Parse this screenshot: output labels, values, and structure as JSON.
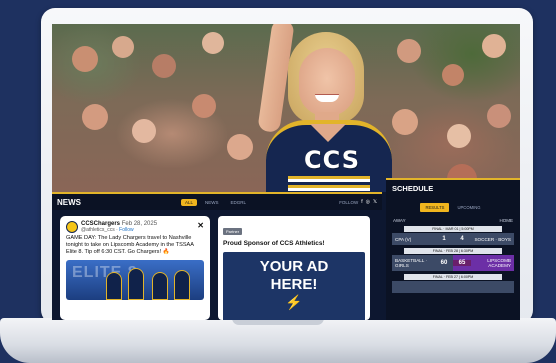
{
  "hero": {
    "jersey_text": "CCS"
  },
  "news": {
    "title": "NEWS",
    "tabs": [
      {
        "label": "ALL",
        "active": true
      },
      {
        "label": "NEWS",
        "active": false
      },
      {
        "label": "EDGRL",
        "active": false
      }
    ],
    "follow_label": "FOLLOW",
    "social_icons": [
      "f",
      "◎",
      "𝕏"
    ]
  },
  "tweet": {
    "name": "CCSChargers",
    "date": "Feb 28, 2025",
    "handle": "@athletics_ccs",
    "follow_label": "Follow",
    "text": "GAME DAY: The Lady Chargers travel to Nashville tonight to take on Lipscomb Academy in the TSSAA Elite 8. Tip off 6:30 CST. Go Chargers! 🔥",
    "image_text": "ELITE 8"
  },
  "ad": {
    "badge": "Partner",
    "sponsor_line": "Proud Sponsor of CCS Athletics!",
    "ad_line1": "YOUR AD",
    "ad_line2": "HERE!"
  },
  "schedule": {
    "title": "SCHEDULE",
    "tabs": [
      {
        "label": "RESULTS",
        "active": true
      },
      {
        "label": "UPCOMING",
        "active": false
      }
    ],
    "col_away": "AWAY",
    "col_home": "HOME",
    "games": [
      {
        "label": "FINAL · MAR 01 | 5:00PM",
        "away": "CPA (V)",
        "away_score": "1",
        "home_score": "4",
        "home": "SOCCER · BOYS"
      },
      {
        "label": "FINAL · FEB 28 | 6:30PM",
        "away": "BASKETBALL · GIRLS",
        "away_score": "60",
        "home_score": "65",
        "home": "LIPSCOMB ACADEMY"
      },
      {
        "label": "FINAL · FEB 27 | 6:00PM",
        "away": "",
        "away_score": "",
        "home_score": "",
        "home": ""
      }
    ]
  },
  "colors": {
    "background": "#1e3160",
    "accent_gold": "#f0b51e",
    "navy": "#152650"
  }
}
